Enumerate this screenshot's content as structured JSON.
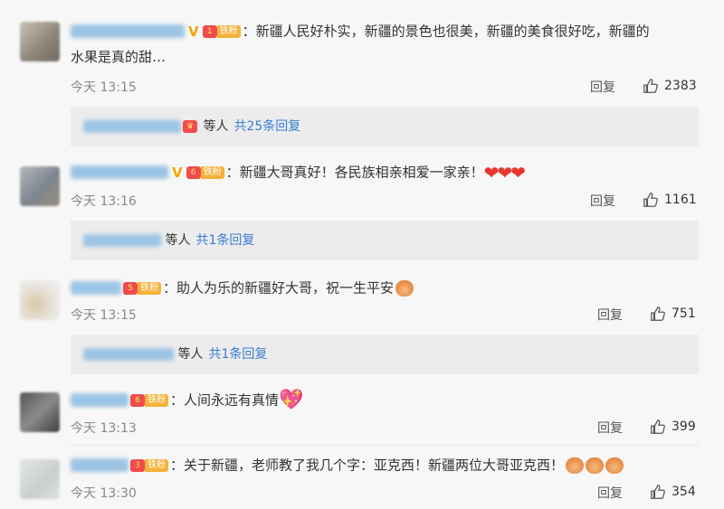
{
  "comments": [
    {
      "text": "：新疆人民好朴实，新疆的景色也很美，新疆的美食很好吃，新疆的",
      "text_cont": "水果是真的甜…",
      "time": "今天 13:15",
      "reply": "回复",
      "likes": "2383",
      "fan_badge": "铁粉",
      "fan_level": "1",
      "sub": {
        "others": "等人",
        "count": "共25条回复"
      }
    },
    {
      "text": "：新疆大哥真好！各民族相亲相爱一家亲！",
      "time": "今天 13:16",
      "reply": "回复",
      "likes": "1161",
      "fan_badge": "铁粉",
      "fan_level": "6",
      "sub": {
        "others": "等人",
        "count": "共1条回复"
      }
    },
    {
      "text": "：助人为乐的新疆好大哥，祝一生平安",
      "time": "今天 13:15",
      "reply": "回复",
      "likes": "751",
      "fan_badge": "铁粉",
      "fan_level": "5",
      "sub": {
        "others": "等人",
        "count": "共1条回复"
      }
    },
    {
      "text": "：人间永远有真情",
      "time": "今天 13:13",
      "reply": "回复",
      "likes": "399",
      "fan_badge": "铁粉",
      "fan_level": "6"
    },
    {
      "text": "：关于新疆，老师教了我几个字：亚克西！新疆两位大哥亚克西！",
      "time": "今天 13:30",
      "reply": "回复",
      "likes": "354",
      "fan_badge": "铁粉",
      "fan_level": "3"
    }
  ],
  "icons": {
    "like": "thumbs-up-icon",
    "heart": "red-heart-emoji",
    "hands": "praying-hands-emoji",
    "pink_heart": "sparkling-heart-emoji"
  },
  "colors": {
    "link": "#3a7bd5",
    "fan_badge": "#f3b23a",
    "vip": "#f2a400"
  }
}
